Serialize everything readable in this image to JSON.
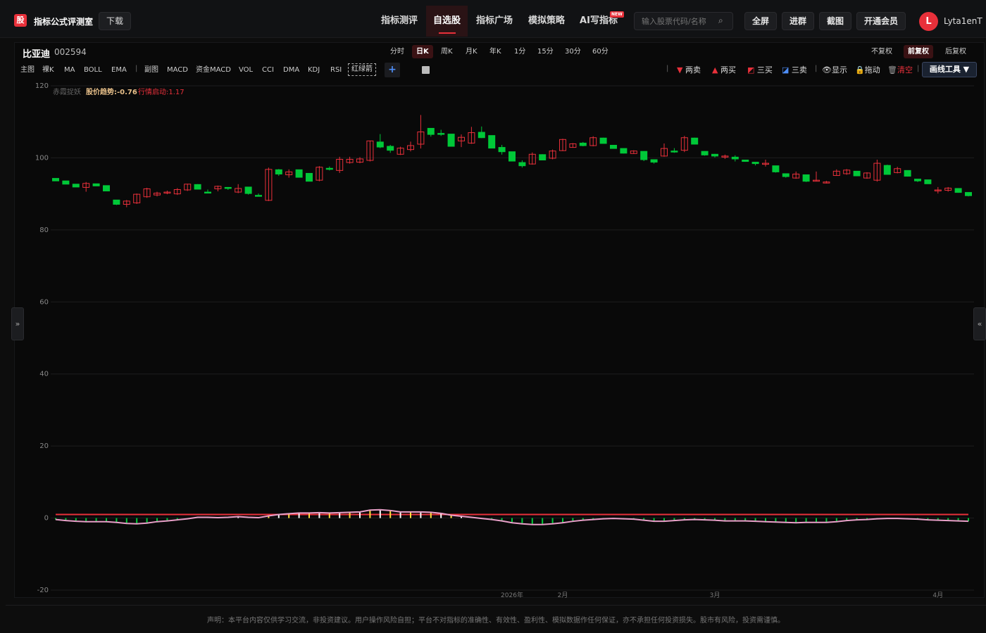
{
  "app": {
    "logo_char": "股",
    "title": "指标公式评测室",
    "download": "下载"
  },
  "nav": {
    "items": [
      "指标测评",
      "自选股",
      "指标广场",
      "模拟策略",
      "AI写指标"
    ],
    "active": "自选股",
    "new_badge": "NEW"
  },
  "search": {
    "placeholder": "输入股票代码/名称"
  },
  "header_buttons": [
    "全屏",
    "进群",
    "截图",
    "开通会员"
  ],
  "user": {
    "avatar_letter": "L",
    "name": "Lyta1enT"
  },
  "stock": {
    "name": "比亚迪",
    "code": "002594"
  },
  "periods": [
    "分时",
    "日K",
    "周K",
    "月K",
    "年K",
    "1分",
    "15分",
    "30分",
    "60分"
  ],
  "active_period": "日K",
  "adjust": [
    "不复权",
    "前复权",
    "后复权"
  ],
  "active_adjust": "前复权",
  "indicators_main": [
    "主图",
    "裸K",
    "MA",
    "BOLL",
    "EMA"
  ],
  "indicators_sub": [
    "副图",
    "MACD",
    "资金MACD",
    "VOL",
    "CCI",
    "DMA",
    "KDJ",
    "RSI"
  ],
  "active_indicator": "红绿箭",
  "tools": {
    "sell2": "两卖",
    "buy2": "两买",
    "buy3": "三买",
    "sell3": "三卖",
    "show": "显示",
    "drag": "拖动",
    "clear": "清空",
    "draw_tools": "画线工具 ▼"
  },
  "chart_legend": {
    "name": "赤霞捉妖",
    "trend_label": "股价趋势:",
    "trend_value": "-0.76",
    "start_label": "行情启动:",
    "start_value": "1.17"
  },
  "colors": {
    "up": "#e8303a",
    "down": "#00c838",
    "bg": "#090909",
    "accent": "#e8303a"
  },
  "chart_data": {
    "type": "candlestick",
    "ylim": [
      -20,
      120
    ],
    "yticks": [
      120,
      100,
      80,
      60,
      40,
      20,
      0,
      -20
    ],
    "xticks": [
      "2026年",
      "2月",
      "3月",
      "4月"
    ],
    "ohlc": [
      [
        94.3,
        94.3,
        93.6,
        93.6
      ],
      [
        93.6,
        93.6,
        92.7,
        92.7
      ],
      [
        92.7,
        92.7,
        91.9,
        91.9
      ],
      [
        91.8,
        93.3,
        90.6,
        92.9
      ],
      [
        92.8,
        92.8,
        92.2,
        92.2
      ],
      [
        92.3,
        92.3,
        90.8,
        90.8
      ],
      [
        88.3,
        88.3,
        86.9,
        87.1
      ],
      [
        87.1,
        88.3,
        86.3,
        88.0
      ],
      [
        87.5,
        90.1,
        87.2,
        89.9
      ],
      [
        89.2,
        91.7,
        88.9,
        91.4
      ],
      [
        89.7,
        90.6,
        89.3,
        90.2
      ],
      [
        90.3,
        90.9,
        89.9,
        90.5
      ],
      [
        90.0,
        91.6,
        89.7,
        91.2
      ],
      [
        91.1,
        92.8,
        90.8,
        92.7
      ],
      [
        92.6,
        92.7,
        91.2,
        91.3
      ],
      [
        90.5,
        91.2,
        90.2,
        90.4
      ],
      [
        91.4,
        92.3,
        90.7,
        92.1
      ],
      [
        91.8,
        91.9,
        91.1,
        91.5
      ],
      [
        90.5,
        92.7,
        90.2,
        91.5
      ],
      [
        91.9,
        91.9,
        89.8,
        90.1
      ],
      [
        89.6,
        90.1,
        89.3,
        89.4
      ],
      [
        88.2,
        97.3,
        88.0,
        96.8
      ],
      [
        96.7,
        96.9,
        95.0,
        95.5
      ],
      [
        95.3,
        96.8,
        94.5,
        96.1
      ],
      [
        96.7,
        96.7,
        94.6,
        94.6
      ],
      [
        95.7,
        95.7,
        93.5,
        93.5
      ],
      [
        93.8,
        97.7,
        93.5,
        97.4
      ],
      [
        97.1,
        97.6,
        96.5,
        96.9
      ],
      [
        96.5,
        100.3,
        95.8,
        99.6
      ],
      [
        98.7,
        100.3,
        98.4,
        99.6
      ],
      [
        98.8,
        100.2,
        98.5,
        99.7
      ],
      [
        99.3,
        104.8,
        99.0,
        104.7
      ],
      [
        104.4,
        106.6,
        102.7,
        103.0
      ],
      [
        103.2,
        103.6,
        101.4,
        102.1
      ],
      [
        101.0,
        103.1,
        100.8,
        102.7
      ],
      [
        102.3,
        104.5,
        101.8,
        103.4
      ],
      [
        103.8,
        111.9,
        102.6,
        107.2
      ],
      [
        108.2,
        108.2,
        105.9,
        106.5
      ],
      [
        106.8,
        107.8,
        106.1,
        106.7
      ],
      [
        106.6,
        106.6,
        103.2,
        103.2
      ],
      [
        104.7,
        106.5,
        103.0,
        105.7
      ],
      [
        104.1,
        108.6,
        103.9,
        107.0
      ],
      [
        107.1,
        108.7,
        105.5,
        105.6
      ],
      [
        106.2,
        106.2,
        102.7,
        102.7
      ],
      [
        102.9,
        103.6,
        100.9,
        101.7
      ],
      [
        101.7,
        101.7,
        99.1,
        99.1
      ],
      [
        98.7,
        99.3,
        97.3,
        97.8
      ],
      [
        98.3,
        101.5,
        98.1,
        101.0
      ],
      [
        100.9,
        101.0,
        99.4,
        99.4
      ],
      [
        99.9,
        102.3,
        99.6,
        101.9
      ],
      [
        102.0,
        105.3,
        101.9,
        105.1
      ],
      [
        102.9,
        104.1,
        102.8,
        103.9
      ],
      [
        104.1,
        104.4,
        103.2,
        103.4
      ],
      [
        103.4,
        106.0,
        103.2,
        105.6
      ],
      [
        105.5,
        105.6,
        104.0,
        104.0
      ],
      [
        103.5,
        103.5,
        102.6,
        102.6
      ],
      [
        102.6,
        102.6,
        101.2,
        101.3
      ],
      [
        101.2,
        102.1,
        101.1,
        101.9
      ],
      [
        101.8,
        101.8,
        99.1,
        99.5
      ],
      [
        99.5,
        99.5,
        98.4,
        98.8
      ],
      [
        100.5,
        104.0,
        100.3,
        102.6
      ],
      [
        101.9,
        102.7,
        101.4,
        101.7
      ],
      [
        102.1,
        106.1,
        101.6,
        105.6
      ],
      [
        105.5,
        105.6,
        103.7,
        103.8
      ],
      [
        101.8,
        101.8,
        100.6,
        100.8
      ],
      [
        101.0,
        101.1,
        100.1,
        100.5
      ],
      [
        100.3,
        100.9,
        99.7,
        100.5
      ],
      [
        100.2,
        100.7,
        99.0,
        99.7
      ],
      [
        99.4,
        99.5,
        98.9,
        99.0
      ],
      [
        98.8,
        98.8,
        97.9,
        98.4
      ],
      [
        98.5,
        99.5,
        97.6,
        98.5
      ],
      [
        97.8,
        97.8,
        95.9,
        96.1
      ],
      [
        95.6,
        95.6,
        94.5,
        94.8
      ],
      [
        94.4,
        96.2,
        94.2,
        95.5
      ],
      [
        95.3,
        95.3,
        93.3,
        93.5
      ],
      [
        93.6,
        96.2,
        93.5,
        93.8
      ],
      [
        93.3,
        93.6,
        92.9,
        93.3
      ],
      [
        95.1,
        96.8,
        95.0,
        96.3
      ],
      [
        95.6,
        96.9,
        95.3,
        96.6
      ],
      [
        96.3,
        96.3,
        94.9,
        95.0
      ],
      [
        94.4,
        96.0,
        94.2,
        95.8
      ],
      [
        93.8,
        99.5,
        93.4,
        98.5
      ],
      [
        97.9,
        98.1,
        95.4,
        95.4
      ],
      [
        95.9,
        97.5,
        95.7,
        97.0
      ],
      [
        96.5,
        96.5,
        94.8,
        94.9
      ],
      [
        94.1,
        94.1,
        93.3,
        93.6
      ],
      [
        93.9,
        93.9,
        92.8,
        92.8
      ],
      [
        91.0,
        91.9,
        90.1,
        91.1
      ],
      [
        91.0,
        91.9,
        90.6,
        91.6
      ],
      [
        91.5,
        91.6,
        90.3,
        90.4
      ],
      [
        90.4,
        90.4,
        89.3,
        89.5
      ]
    ],
    "osc_line": [
      -0.4,
      -0.7,
      -0.9,
      -1.0,
      -1.0,
      -1.0,
      -1.2,
      -1.5,
      -1.6,
      -1.4,
      -1.0,
      -0.8,
      -0.5,
      -0.2,
      0.2,
      0.2,
      0.1,
      0.2,
      0.4,
      0.2,
      0.1,
      0.6,
      1.0,
      1.2,
      1.4,
      1.4,
      1.5,
      1.4,
      1.5,
      1.6,
      1.7,
      2.2,
      2.3,
      2.1,
      1.7,
      1.7,
      1.7,
      1.6,
      1.3,
      0.8,
      0.5,
      0.2,
      -0.1,
      -0.4,
      -0.8,
      -1.3,
      -1.6,
      -1.8,
      -1.8,
      -1.6,
      -1.3,
      -0.9,
      -0.6,
      -0.4,
      -0.2,
      -0.1,
      -0.2,
      -0.3,
      -0.6,
      -0.9,
      -0.9,
      -0.7,
      -0.5,
      -0.4,
      -0.5,
      -0.6,
      -0.8,
      -0.8,
      -0.8,
      -0.9,
      -1.0,
      -1.1,
      -1.2,
      -1.3,
      -1.2,
      -1.2,
      -1.2,
      -1.0,
      -0.7,
      -0.5,
      -0.4,
      -0.2,
      -0.1,
      -0.1,
      -0.2,
      -0.3,
      -0.5,
      -0.6,
      -0.7,
      -0.8,
      -0.9
    ],
    "signal_line": 1.0,
    "legend": [
      "赤霞捉妖",
      "股价趋势",
      "行情启动"
    ]
  },
  "disclaimer": "声明：本平台内容仅供学习交流，非投资建议。用户操作风险自担；平台不对指标的准确性、有效性、盈利性、模拟数据作任何保证，亦不承担任何投资损失。股市有风险，投资需谨慎。"
}
